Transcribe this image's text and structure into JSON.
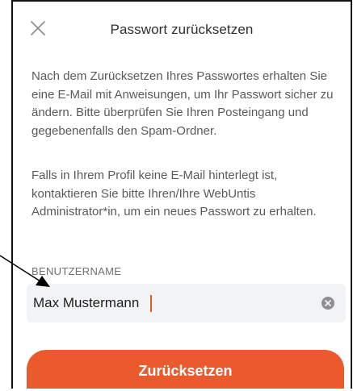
{
  "header": {
    "title": "Passwort zurücksetzen",
    "close_icon": "close-icon"
  },
  "content": {
    "paragraph1": "Nach dem Zurücksetzen Ihres Passwortes erhalten Sie eine E-Mail mit Anweisungen, um Ihr Passwort sicher zu ändern. Bitte überprüfen Sie Ihren Posteingang und gegebenenfalls den Spam-Ordner.",
    "paragraph2": "Falls in Ihrem Profil keine E-Mail hinterlegt ist, kontaktieren Sie bitte Ihren/Ihre WebUntis Administrator*in, um ein neues Passwort zu erhalten."
  },
  "username_field": {
    "label": "BENUTZERNAME",
    "value": "Max Mustermann",
    "clear_icon": "clear-icon"
  },
  "submit": {
    "label": "Zurücksetzen"
  },
  "colors": {
    "accent": "#ea5a2c",
    "field_background": "#f2f3f5",
    "text": "#5a5a5a"
  }
}
